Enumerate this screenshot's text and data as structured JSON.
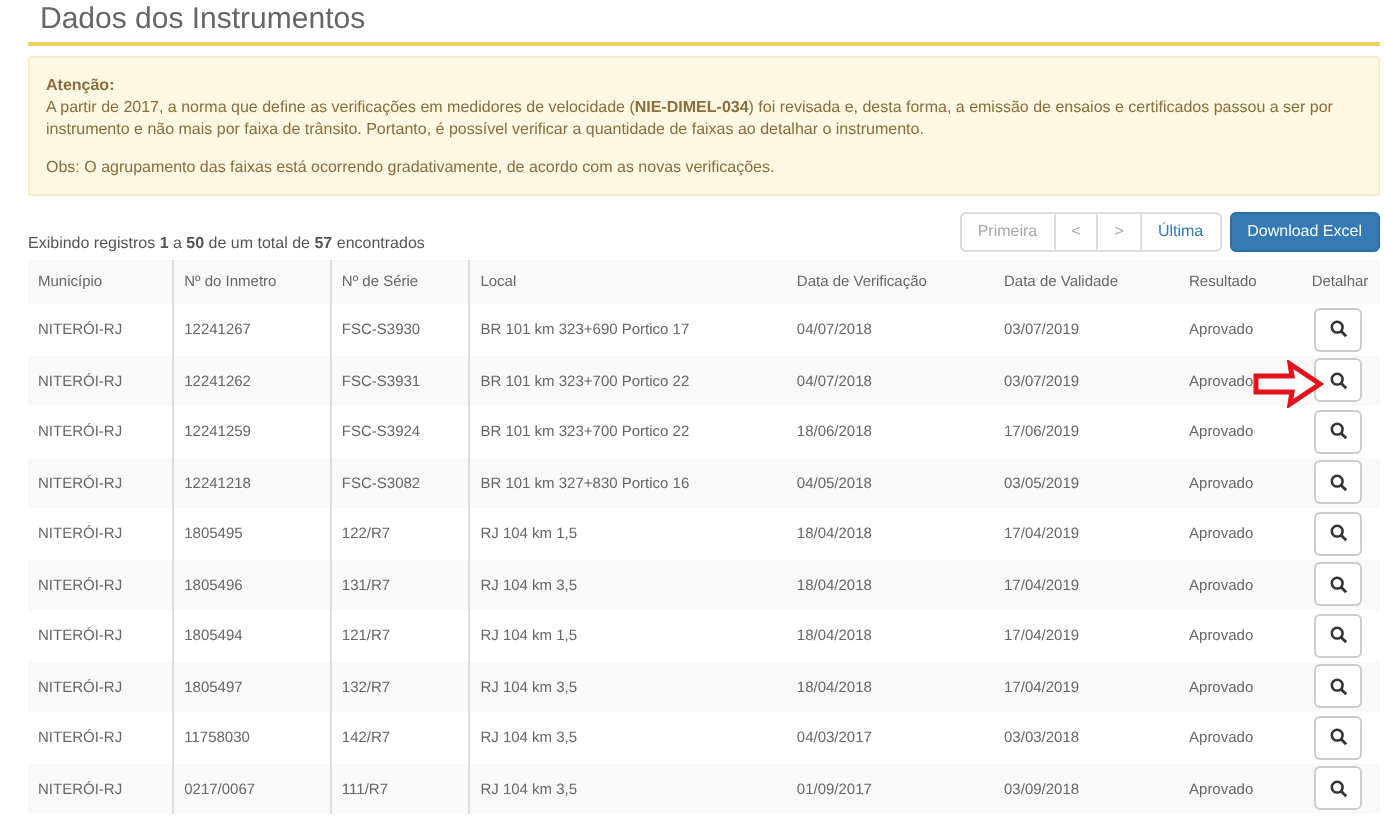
{
  "title": "Dados dos Instrumentos",
  "alert": {
    "heading": "Atenção:",
    "body": "A partir de 2017, a norma que define as verificações em medidores de velocidade (**NIE-DIMEL-034**) foi revisada e, desta forma, a emissão de ensaios e certificados passou a ser por instrumento e não mais por faixa de trânsito. Portanto, é possível verificar a quantidade de faixas ao detalhar o instrumento.",
    "note": "Obs: O agrupamento das faixas está ocorrendo gradativamente, de acordo com as novas verificações."
  },
  "summary": "Exibindo registros **1** a **50** de um total de **57** encontrados",
  "pagination": [
    {
      "label": "Primeira",
      "disabled": true
    },
    {
      "label": "<",
      "disabled": true
    },
    {
      "label": ">",
      "disabled": true
    },
    {
      "label": "Última",
      "disabled": false
    }
  ],
  "download_button": "Download Excel",
  "table": {
    "columns": [
      "Município",
      "Nº do Inmetro",
      "Nº de Série",
      "Local",
      "Data de Verificação",
      "Data de Validade",
      "Resultado",
      "Detalhar"
    ],
    "rows": [
      [
        "NITERÓI-RJ",
        "12241267",
        "FSC-S3930",
        "BR 101 km 323+690 Portico 17",
        "04/07/2018",
        "03/07/2019",
        "Aprovado"
      ],
      [
        "NITERÓI-RJ",
        "12241262",
        "FSC-S3931",
        "BR 101 km 323+700 Portico 22",
        "04/07/2018",
        "03/07/2019",
        "Aprovado"
      ],
      [
        "NITERÓI-RJ",
        "12241259",
        "FSC-S3924",
        "BR 101 km 323+700 Portico 22",
        "18/06/2018",
        "17/06/2019",
        "Aprovado"
      ],
      [
        "NITERÓI-RJ",
        "12241218",
        "FSC-S3082",
        "BR 101 km 327+830 Portico 16",
        "04/05/2018",
        "03/05/2019",
        "Aprovado"
      ],
      [
        "NITERÓI-RJ",
        "1805495",
        "122/R7",
        "RJ 104 km 1,5",
        "18/04/2018",
        "17/04/2019",
        "Aprovado"
      ],
      [
        "NITERÓI-RJ",
        "1805496",
        "131/R7",
        "RJ 104 km 3,5",
        "18/04/2018",
        "17/04/2019",
        "Aprovado"
      ],
      [
        "NITERÓI-RJ",
        "1805494",
        "121/R7",
        "RJ 104 km 1,5",
        "18/04/2018",
        "17/04/2019",
        "Aprovado"
      ],
      [
        "NITERÓI-RJ",
        "1805497",
        "132/R7",
        "RJ 104 km 3,5",
        "18/04/2018",
        "17/04/2019",
        "Aprovado"
      ],
      [
        "NITERÓI-RJ",
        "11758030",
        "142/R7",
        "RJ 104 km 3,5",
        "04/03/2017",
        "03/03/2018",
        "Aprovado"
      ],
      [
        "NITERÓI-RJ",
        "0217/0067",
        "111/R7",
        "RJ 104 km 3,5",
        "01/09/2017",
        "03/09/2018",
        "Aprovado"
      ]
    ]
  }
}
